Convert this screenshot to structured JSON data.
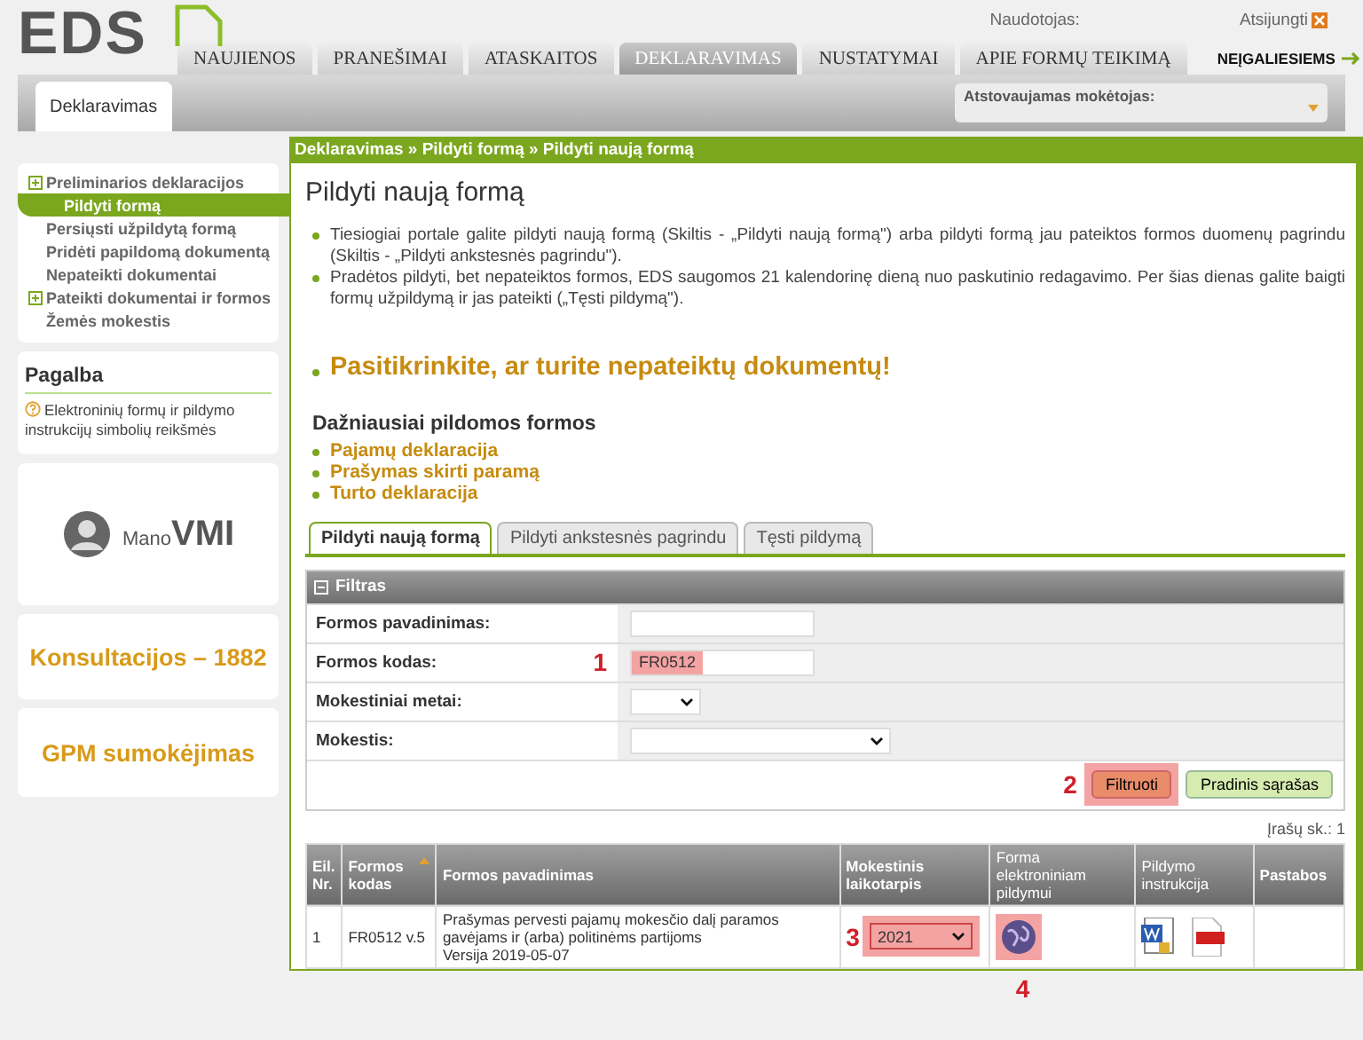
{
  "header": {
    "logo": "EDS",
    "user_label": "Naudotojas:",
    "logout": "Atsijungti",
    "accessibility_link": "NEĮGALIESIEMS",
    "nav": [
      {
        "label": "NAUJIENOS",
        "selected": false
      },
      {
        "label": "PRANEŠIMAI",
        "selected": false
      },
      {
        "label": "ATASKAITOS",
        "selected": false
      },
      {
        "label": "DEKLARAVIMAS",
        "selected": true
      },
      {
        "label": "NUSTATYMAI",
        "selected": false
      },
      {
        "label": "APIE FORMŲ TEIKIMĄ",
        "selected": false
      }
    ]
  },
  "subbar": {
    "tab": "Deklaravimas",
    "payer_label": "Atstovaujamas mokėtojas:"
  },
  "sidebar": {
    "items": [
      {
        "label": "Preliminarios deklaracijos",
        "expandable": true,
        "selected": false
      },
      {
        "label": "Pildyti formą",
        "expandable": false,
        "selected": true
      },
      {
        "label": "Persiųsti užpildytą formą",
        "expandable": false,
        "selected": false
      },
      {
        "label": "Pridėti papildomą dokumentą",
        "expandable": false,
        "selected": false
      },
      {
        "label": "Nepateikti dokumentai",
        "expandable": false,
        "selected": false
      },
      {
        "label": "Pateikti dokumentai ir formos",
        "expandable": true,
        "selected": false
      },
      {
        "label": "Žemės mokestis",
        "expandable": false,
        "selected": false
      }
    ],
    "help": {
      "title": "Pagalba",
      "text": "Elektroninių formų ir pildymo instrukcijų simbolių reikšmės"
    },
    "mano_vmi": {
      "prefix": "Mano",
      "name": "VMI"
    },
    "promos": [
      "Konsultacijos – 1882",
      "GPM sumokėjimas"
    ]
  },
  "breadcrumb": "Deklaravimas » Pildyti formą » Pildyti naują formą",
  "main": {
    "title": "Pildyti naują formą",
    "bullets": [
      "Tiesiogiai portale galite pildyti naują formą (Skiltis - „Pildyti naują formą\") arba pildyti formą jau pateiktos formos duomenų pagrindu (Skiltis - „Pildyti ankstesnės pagrindu\").",
      "Pradėtos pildyti, bet nepateiktos formos, EDS saugomos 21 kalendorinę dieną nuo paskutinio redagavimo. Per šias dienas galite baigti formų užpildymą ir jas pateikti („Tęsti pildymą\")."
    ],
    "notice": "Pasitikrinkite, ar turite nepateiktų dokumentų!",
    "frequent_title": "Dažniausiai pildomos formos",
    "frequent_links": [
      "Pajamų deklaracija",
      "Prašymas skirti paramą",
      "Turto deklaracija"
    ]
  },
  "tabs": [
    {
      "label": "Pildyti naują formą",
      "selected": true
    },
    {
      "label": "Pildyti ankstesnės pagrindu",
      "selected": false
    },
    {
      "label": "Tęsti pildymą",
      "selected": false
    }
  ],
  "filter": {
    "title": "Filtras",
    "fields": [
      {
        "label": "Formos pavadinimas:",
        "kind": "text"
      },
      {
        "label": "Formos kodas:",
        "kind": "text",
        "value": "FR0512",
        "annotation": "1"
      },
      {
        "label": "Mokestiniai metai:",
        "kind": "small-select"
      },
      {
        "label": "Mokestis:",
        "kind": "select"
      }
    ],
    "buttons": [
      {
        "label": "Filtruoti",
        "annotation": "2"
      },
      {
        "label": "Pradinis sąrašas"
      }
    ]
  },
  "record_count": "Įrašų sk.: 1",
  "table": {
    "columns": [
      "Eil. Nr.",
      "Formos kodas",
      "Formos pavadinimas",
      "Mokestinis laikotarpis",
      "Forma elektroniniam pildymui",
      "Pildymo instrukcija",
      "Pastabos"
    ],
    "rows": [
      {
        "number": "1",
        "code": "FR0512 v.5",
        "name": "Prašymas pervesti pajamų mokesčio dalį paramos gavėjams ir (arba) politinėms partijoms",
        "version": "Versija 2019-05-07",
        "period": "2021",
        "period_annotation": "3",
        "form_annotation": "4"
      }
    ]
  }
}
